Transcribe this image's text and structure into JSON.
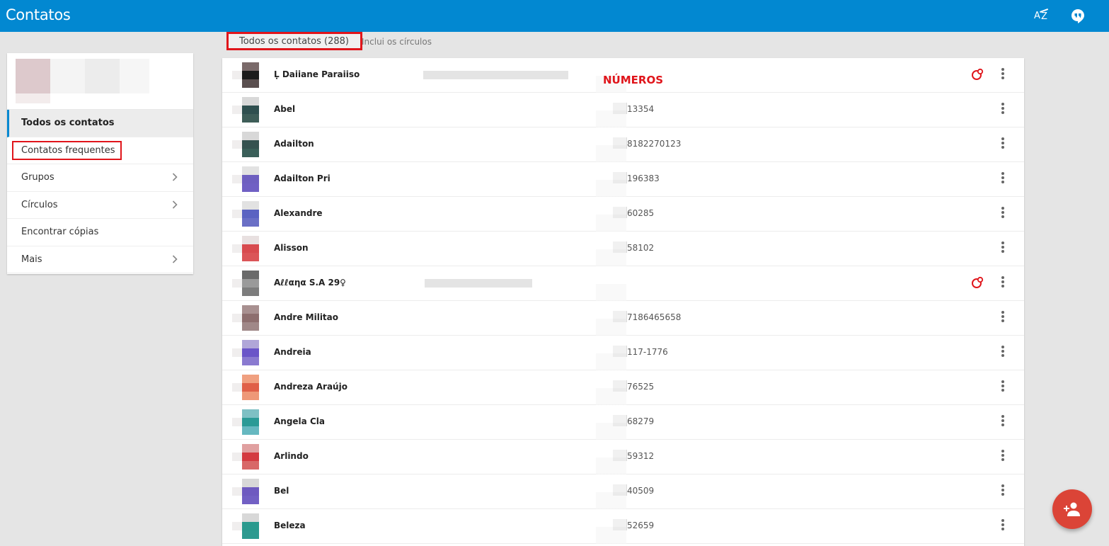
{
  "app": {
    "title": "Contatos"
  },
  "header": {
    "sort_icon": "sort-az-icon",
    "hangouts_icon": "hangouts-icon"
  },
  "filter": {
    "label": "Todos os contatos (288)",
    "note": "Inclui os círculos"
  },
  "annotation": {
    "label": "NÚMEROS",
    "color": "#e0151b"
  },
  "sidebar": {
    "items": [
      {
        "label": "Todos os contatos",
        "active": true,
        "chevron": false
      },
      {
        "label": "Contatos frequentes",
        "active": false,
        "chevron": false
      },
      {
        "label": "Grupos",
        "active": false,
        "chevron": true
      },
      {
        "label": "Círculos",
        "active": false,
        "chevron": true
      },
      {
        "label": "Encontrar cópias",
        "active": false,
        "chevron": false
      },
      {
        "label": "Mais",
        "active": false,
        "chevron": true
      }
    ]
  },
  "contacts": [
    {
      "name": "Ḷ Daiiane Paraiiso",
      "phone": "",
      "circles": true,
      "colors": [
        "#7a6a6a",
        "#1c1c1c",
        "#5a4f4f"
      ]
    },
    {
      "name": "Abel",
      "phone": "13354",
      "circles": false,
      "colors": [
        "#d8d8d8",
        "#2f4f4f",
        "#3e5d58"
      ]
    },
    {
      "name": "Adailton",
      "phone": "8182270123",
      "circles": false,
      "colors": [
        "#d8d8d8",
        "#355250",
        "#3a5f59"
      ]
    },
    {
      "name": "Adailton Pri",
      "phone": "196383",
      "circles": false,
      "colors": [
        "#e2e2e2",
        "#6e5fc0",
        "#7060c4"
      ]
    },
    {
      "name": "Alexandre",
      "phone": "60285",
      "circles": false,
      "colors": [
        "#e2e2e2",
        "#5b63c2",
        "#6a6fc6"
      ]
    },
    {
      "name": "Alisson",
      "phone": "58102",
      "circles": false,
      "colors": [
        "#e8e0e0",
        "#d84a4e",
        "#db5558"
      ]
    },
    {
      "name": "Aℓℓαηα S.A 29♀",
      "phone": "",
      "circles": true,
      "colors": [
        "#6a6a6a",
        "#9a9a9a",
        "#7d7d7d"
      ]
    },
    {
      "name": "Andre Militao",
      "phone": "7186465658",
      "circles": false,
      "colors": [
        "#a89090",
        "#8d6e6e",
        "#a08888"
      ]
    },
    {
      "name": "Andreia",
      "phone": "117-1776",
      "circles": false,
      "colors": [
        "#b0a6d8",
        "#6a55c8",
        "#8a7ad0"
      ]
    },
    {
      "name": "Andreza Araújo",
      "phone": "76525",
      "circles": false,
      "colors": [
        "#f0a080",
        "#e06048",
        "#ee9878"
      ]
    },
    {
      "name": "Angela Cla",
      "phone": "68279",
      "circles": false,
      "colors": [
        "#7ec0c4",
        "#2a9a96",
        "#66b8c0"
      ]
    },
    {
      "name": "Arlindo",
      "phone": "59312",
      "circles": false,
      "colors": [
        "#e0a0a0",
        "#d43a40",
        "#d86868"
      ]
    },
    {
      "name": "Bel",
      "phone": "40509",
      "circles": false,
      "colors": [
        "#d8d8d8",
        "#6e5ac0",
        "#7260c4"
      ]
    },
    {
      "name": "Beleza",
      "phone": "52659",
      "circles": false,
      "colors": [
        "#d8d8d8",
        "#2a9a8e",
        "#2e9a90"
      ]
    }
  ],
  "fab": {
    "icon": "add-contact-icon",
    "color": "#db4437"
  }
}
